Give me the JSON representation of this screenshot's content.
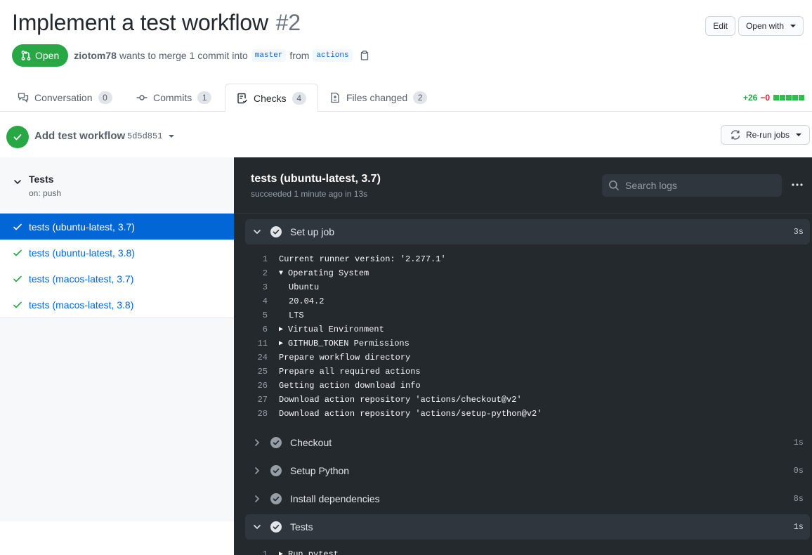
{
  "pr": {
    "title": "Implement a test workflow",
    "number": "#2",
    "state": "Open",
    "author": "ziotom78",
    "merge_text": "wants to merge 1 commit into",
    "base_branch": "master",
    "from_text": "from",
    "head_branch": "actions",
    "edit_label": "Edit",
    "open_with_label": "Open with"
  },
  "tabs": [
    {
      "label": "Conversation",
      "count": "0",
      "icon": "comment-discussion-icon"
    },
    {
      "label": "Commits",
      "count": "1",
      "icon": "git-commit-icon"
    },
    {
      "label": "Checks",
      "count": "4",
      "icon": "checklist-icon",
      "selected": true
    },
    {
      "label": "Files changed",
      "count": "2",
      "icon": "file-diff-icon"
    }
  ],
  "diffstat": {
    "additions": "+26",
    "deletions": "−0"
  },
  "commit": {
    "message": "Add test workflow",
    "sha": "5d5d851",
    "rerun_label": "Re-run jobs"
  },
  "workflow": {
    "name": "Tests",
    "trigger": "on: push",
    "jobs": [
      {
        "label": "tests (ubuntu-latest, 3.7)",
        "active": true
      },
      {
        "label": "tests (ubuntu-latest, 3.8)"
      },
      {
        "label": "tests (macos-latest, 3.7)"
      },
      {
        "label": "tests (macos-latest, 3.8)"
      }
    ]
  },
  "log": {
    "title": "tests (ubuntu-latest, 3.7)",
    "subtitle": "succeeded 1 minute ago in 13s",
    "search_placeholder": "Search logs",
    "steps": [
      {
        "name": "Set up job",
        "duration": "3s",
        "expanded": true
      },
      {
        "name": "Checkout",
        "duration": "1s"
      },
      {
        "name": "Setup Python",
        "duration": "0s"
      },
      {
        "name": "Install dependencies",
        "duration": "8s"
      },
      {
        "name": "Tests",
        "duration": "1s",
        "expanded": true
      }
    ],
    "setup_lines": [
      {
        "n": "1",
        "text": "Current runner version: '2.277.1'"
      },
      {
        "n": "2",
        "text": "Operating System",
        "marker": "▼"
      },
      {
        "n": "3",
        "text": "Ubuntu",
        "indent": true
      },
      {
        "n": "4",
        "text": "20.04.2",
        "indent": true
      },
      {
        "n": "5",
        "text": "LTS",
        "indent": true
      },
      {
        "n": "6",
        "text": "Virtual Environment",
        "marker": "▶"
      },
      {
        "n": "11",
        "text": "GITHUB_TOKEN Permissions",
        "marker": "▶"
      },
      {
        "n": "24",
        "text": "Prepare workflow directory"
      },
      {
        "n": "25",
        "text": "Prepare all required actions"
      },
      {
        "n": "26",
        "text": "Getting action download info"
      },
      {
        "n": "27",
        "text": "Download action repository 'actions/checkout@v2'"
      },
      {
        "n": "28",
        "text": "Download action repository 'actions/setup-python@v2'"
      }
    ],
    "tests_lines": [
      {
        "n": "1",
        "text": "Run pytest",
        "marker": "▶"
      }
    ]
  }
}
